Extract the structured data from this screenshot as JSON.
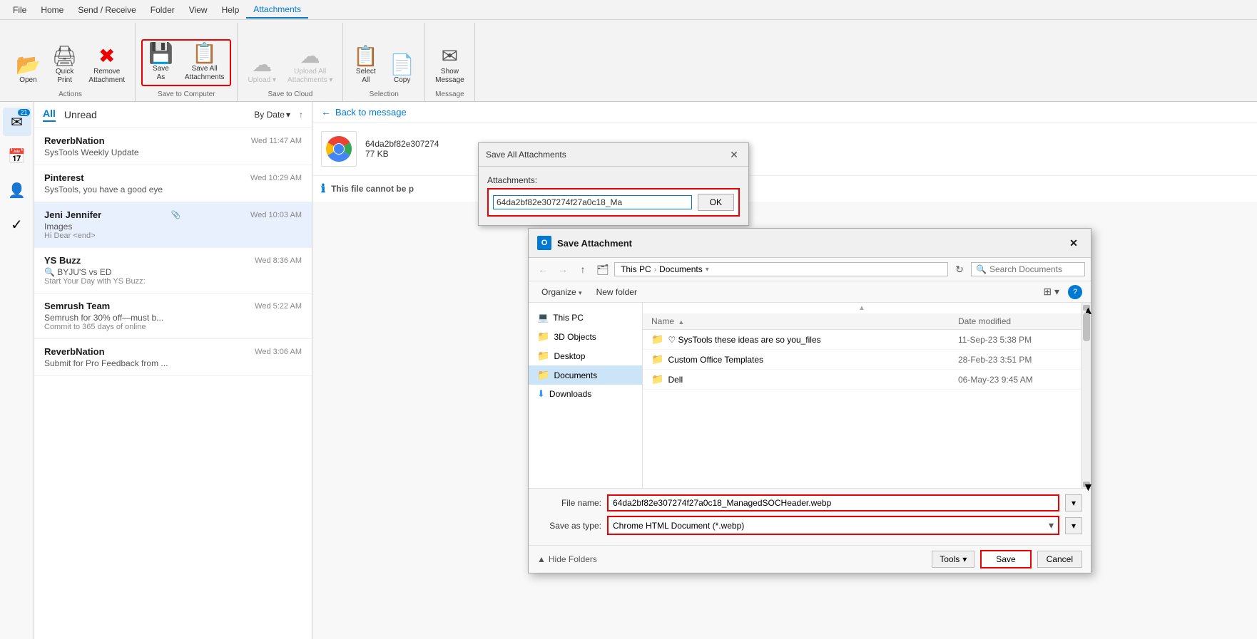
{
  "menubar": {
    "items": [
      "File",
      "Home",
      "Send / Receive",
      "Folder",
      "View",
      "Help",
      "Attachments"
    ]
  },
  "ribbon": {
    "groups": [
      {
        "label": "Actions",
        "items": [
          {
            "id": "open",
            "icon": "📂",
            "label": "Open",
            "disabled": false
          },
          {
            "id": "quick-print",
            "icon": "🖨",
            "label": "Quick\nPrint",
            "disabled": false
          },
          {
            "id": "remove-attachment",
            "icon": "✖",
            "label": "Remove\nAttachment",
            "disabled": false
          }
        ]
      },
      {
        "label": "Save to Computer",
        "highlighted": true,
        "items": [
          {
            "id": "save-as",
            "icon": "💾",
            "label": "Save\nAs",
            "disabled": false
          },
          {
            "id": "save-all-attachments",
            "icon": "📋",
            "label": "Save All\nAttachments",
            "disabled": false
          }
        ]
      },
      {
        "label": "Save to Cloud",
        "items": [
          {
            "id": "upload",
            "icon": "☁",
            "label": "Upload",
            "disabled": true
          },
          {
            "id": "upload-all-attachments",
            "icon": "☁",
            "label": "Upload All\nAttachments",
            "disabled": true
          }
        ]
      },
      {
        "label": "Selection",
        "items": [
          {
            "id": "select-all",
            "icon": "📋",
            "label": "Select\nAll",
            "disabled": false
          },
          {
            "id": "copy",
            "icon": "📄",
            "label": "Copy",
            "disabled": false
          }
        ]
      },
      {
        "label": "Message",
        "items": [
          {
            "id": "show-message",
            "icon": "✉",
            "label": "Show\nMessage",
            "disabled": false
          }
        ]
      }
    ]
  },
  "email_list": {
    "tabs": {
      "all": "All",
      "unread": "Unread"
    },
    "filter": "By Date",
    "inbox_badge": "21",
    "emails": [
      {
        "sender": "ReverbNation",
        "subject": "SysTools Weekly Update",
        "preview": "",
        "date": "Wed 11:47 AM",
        "has_attachment": false,
        "selected": false
      },
      {
        "sender": "Pinterest",
        "subject": "SysTools, you have a good eye",
        "preview": "",
        "date": "Wed 10:29 AM",
        "has_attachment": false,
        "selected": false
      },
      {
        "sender": "Jeni Jennifer",
        "subject": "Images",
        "preview": "Hi Dear <end>",
        "date": "Wed 10:03 AM",
        "has_attachment": true,
        "selected": true
      },
      {
        "sender": "YS Buzz",
        "subject": "🔍 BYJU'S vs ED",
        "preview": "Start Your Day with YS Buzz:",
        "date": "Wed 8:36 AM",
        "has_attachment": false,
        "selected": false
      },
      {
        "sender": "Semrush Team",
        "subject": "Semrush for 30% off—must b...",
        "preview": "Commit to 365 days of online",
        "date": "Wed 5:22 AM",
        "has_attachment": false,
        "selected": false
      },
      {
        "sender": "ReverbNation",
        "subject": "Submit for Pro Feedback from ...",
        "preview": "",
        "date": "Wed 3:06 AM",
        "has_attachment": false,
        "selected": false
      }
    ]
  },
  "main": {
    "back_label": "Back to message",
    "attachment_filename": "64da2bf82e307274",
    "attachment_size": "77 KB",
    "file_warning": "This file cannot be p"
  },
  "save_all_dialog": {
    "title": "Save All Attachments",
    "attachments_label": "Attachments:",
    "attachment_name": "64da2bf82e307274f27a0c18_Ma",
    "ok_label": "OK"
  },
  "save_attachment_dialog": {
    "title": "Save Attachment",
    "path": {
      "this_pc": "This PC",
      "documents": "Documents"
    },
    "search_placeholder": "Search Documents",
    "organize_label": "Organize",
    "new_folder_label": "New folder",
    "columns": {
      "name": "Name",
      "date_modified": "Date modified"
    },
    "files": [
      {
        "name": "♡ SysTools these ideas are so you_files",
        "date": "11-Sep-23 5:38 PM"
      },
      {
        "name": "Custom Office Templates",
        "date": "28-Feb-23 3:51 PM"
      },
      {
        "name": "Dell",
        "date": "06-May-23 9:45 AM"
      }
    ],
    "sidebar_items": [
      {
        "label": "This PC",
        "icon": "pc",
        "selected": false
      },
      {
        "label": "3D Objects",
        "icon": "folder",
        "selected": false
      },
      {
        "label": "Desktop",
        "icon": "folder",
        "selected": false
      },
      {
        "label": "Documents",
        "icon": "folder",
        "selected": true
      },
      {
        "label": "Downloads",
        "icon": "download",
        "selected": false
      }
    ],
    "filename_label": "File name:",
    "filename_value": "64da2bf82e307274f27a0c18_ManagedSOCHeader.webp",
    "save_as_type_label": "Save as type:",
    "save_as_type_value": "Chrome HTML Document (*.webp)",
    "hide_folders_label": "Hide Folders",
    "tools_label": "Tools",
    "save_label": "Save",
    "cancel_label": "Cancel"
  },
  "nav_icons": [
    {
      "icon": "✉",
      "label": "inbox",
      "badge": "21"
    },
    {
      "icon": "📅",
      "label": "calendar",
      "badge": ""
    },
    {
      "icon": "👤",
      "label": "contacts",
      "badge": ""
    },
    {
      "icon": "✓",
      "label": "tasks",
      "badge": ""
    }
  ]
}
